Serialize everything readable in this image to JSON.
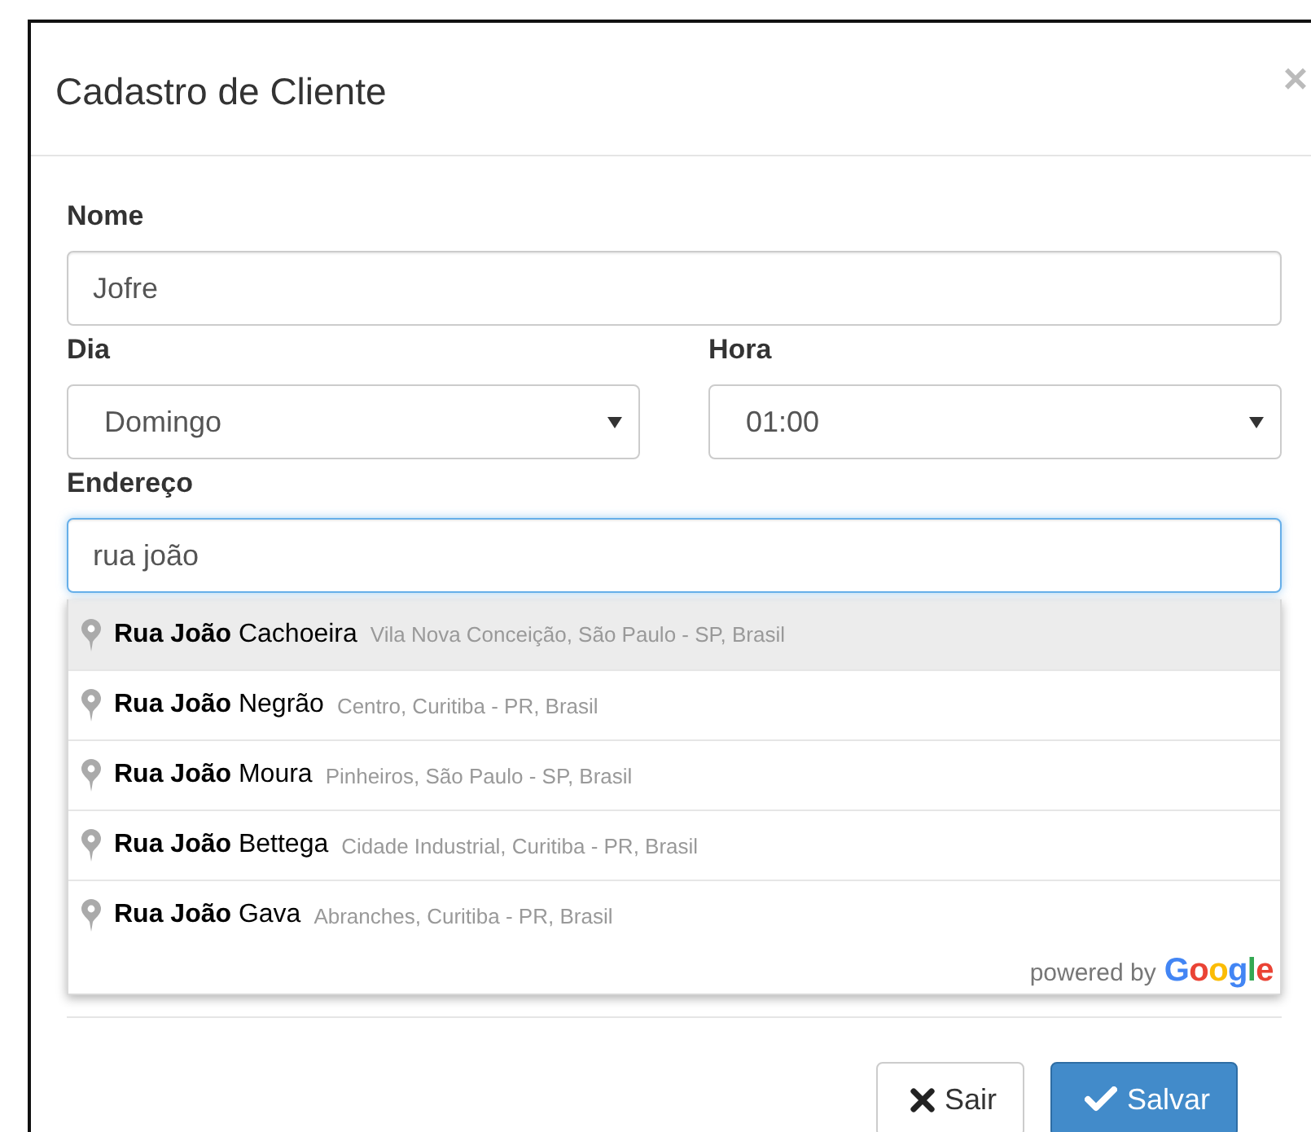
{
  "modal": {
    "title": "Cadastro de Cliente",
    "close": "×"
  },
  "fields": [
    {
      "kind": "text",
      "label": "Nome",
      "value": "Jofre"
    },
    {
      "kind": "select",
      "label": "Dia",
      "value": "Domingo"
    },
    {
      "kind": "select",
      "label": "Hora",
      "value": "01:00"
    },
    {
      "kind": "text",
      "label": "Endereço",
      "value": "rua joão",
      "focused": true
    }
  ],
  "suggestions": [
    {
      "main": "**Rua João** Cachoeira",
      "secondary": "Vila Nova Conceição, São Paulo - SP, Brasil",
      "selected": true
    },
    {
      "main": "**Rua João** Negrão",
      "secondary": "Centro, Curitiba - PR, Brasil",
      "selected": false
    },
    {
      "main": "**Rua João** Moura",
      "secondary": "Pinheiros, São Paulo - SP, Brasil",
      "selected": false
    },
    {
      "main": "**Rua João** Bettega",
      "secondary": "Cidade Industrial, Curitiba - PR, Brasil",
      "selected": false
    },
    {
      "main": "**Rua João** Gava",
      "secondary": "Abranches, Curitiba - PR, Brasil",
      "selected": false
    }
  ],
  "attribution": {
    "prefix": "powered by",
    "logo": "Google"
  },
  "buttons": [
    {
      "kind": "default",
      "label": "Sair"
    },
    {
      "kind": "primary",
      "label": "Salvar"
    }
  ]
}
